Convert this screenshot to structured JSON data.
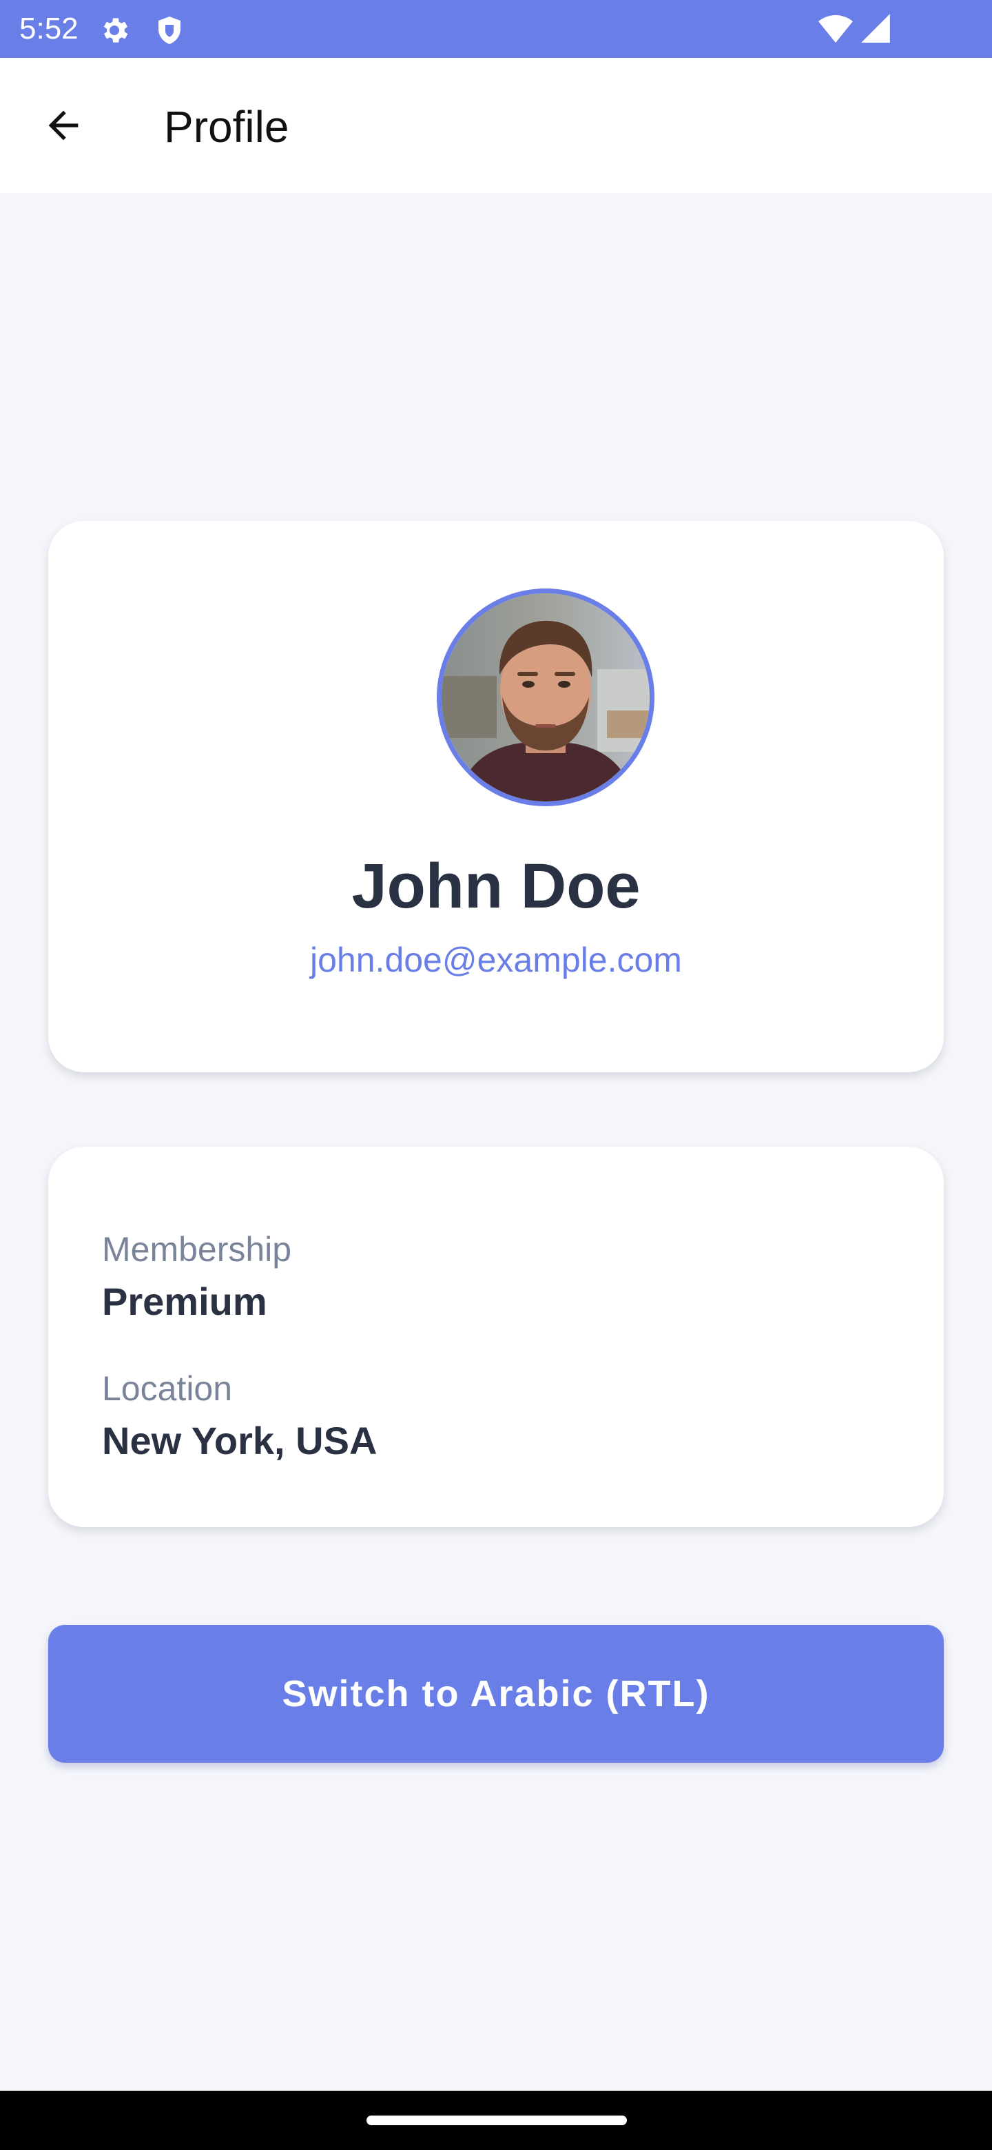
{
  "status_bar": {
    "time": "5:52",
    "background": "#6A7EE8",
    "icons": [
      "gear-icon",
      "shield-icon",
      "wifi-icon",
      "signal-icon"
    ]
  },
  "app_bar": {
    "title": "Profile",
    "back_icon": "arrow-back-icon"
  },
  "profile": {
    "name": "John Doe",
    "email": "john.doe@example.com",
    "avatar_border_color": "#6A7EE8"
  },
  "info": {
    "membership_label": "Membership",
    "membership_value": "Premium",
    "location_label": "Location",
    "location_value": "New York, USA"
  },
  "actions": {
    "switch_language_label": "Switch to Arabic (RTL)"
  },
  "colors": {
    "accent": "#6A7EE8",
    "text_primary": "#2A3142",
    "text_secondary": "#7A8499",
    "page_background": "#F5F6FA"
  }
}
